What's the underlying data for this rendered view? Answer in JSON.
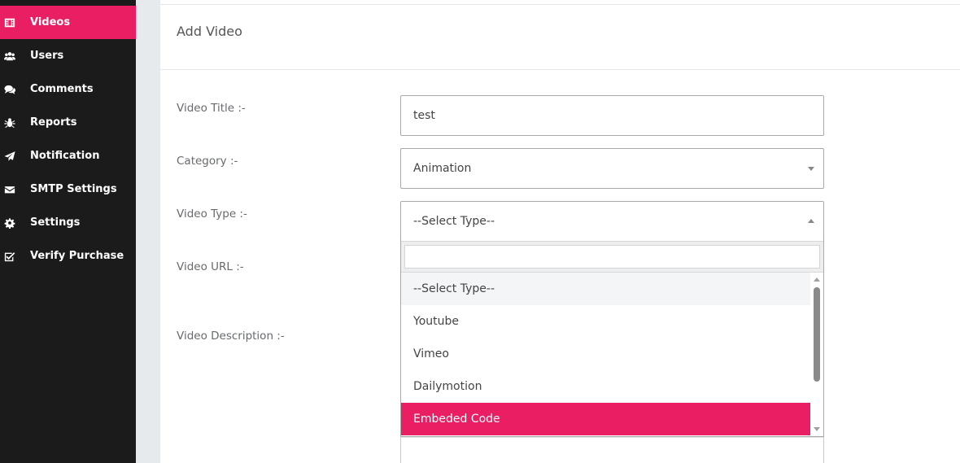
{
  "sidebar": {
    "items": [
      {
        "label": "Videos",
        "icon": "film-icon",
        "active": true
      },
      {
        "label": "Users",
        "icon": "users-icon",
        "active": false
      },
      {
        "label": "Comments",
        "icon": "comments-icon",
        "active": false
      },
      {
        "label": "Reports",
        "icon": "bug-icon",
        "active": false
      },
      {
        "label": "Notification",
        "icon": "paper-plane-icon",
        "active": false
      },
      {
        "label": "SMTP Settings",
        "icon": "envelope-icon",
        "active": false
      },
      {
        "label": "Settings",
        "icon": "gear-icon",
        "active": false
      },
      {
        "label": "Verify Purchase",
        "icon": "check-square-icon",
        "active": false
      }
    ]
  },
  "form": {
    "title": "Add Video",
    "video_title_label": "Video Title :-",
    "video_title_value": "test",
    "category_label": "Category :-",
    "category_value": "Animation",
    "video_type_label": "Video Type :-",
    "video_type_value": "--Select Type--",
    "video_url_label": "Video URL :-",
    "video_description_label": "Video Description :-"
  },
  "video_type_dropdown": {
    "search_value": "",
    "options": [
      "--Select Type--",
      "Youtube",
      "Vimeo",
      "Dailymotion",
      "Embeded Code"
    ],
    "selected": "--Select Type--",
    "highlighted": "Embeded Code"
  },
  "colors": {
    "accent": "#ea1e63",
    "sidebar_bg": "#1b1b1b",
    "gutter_bg": "#e7eaec"
  }
}
